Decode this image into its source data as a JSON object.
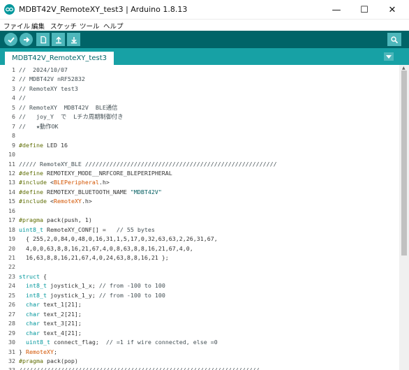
{
  "window": {
    "title": "MDBT42V_RemoteXY_test3 | Arduino 1.8.13",
    "min_glyph": "—",
    "max_glyph": "☐",
    "close_glyph": "✕"
  },
  "menu": [
    "ファイル",
    "編集",
    "スケッチ",
    "ツール",
    "ヘルプ"
  ],
  "toolbar": {
    "verify": "verify-icon",
    "upload": "upload-icon",
    "new": "new-icon",
    "open": "open-icon",
    "save": "save-icon",
    "serial_monitor": "serial-monitor-icon"
  },
  "tabs": [
    {
      "label": "MDBT42V_RemoteXY_test3",
      "active": true
    }
  ],
  "colors": {
    "toolbar_bg": "#006468",
    "tabbar_bg": "#17a1a5",
    "button_bg": "#4db7bb",
    "keyword": "#00979c",
    "preprocessor": "#5e6d03",
    "type": "#d35400",
    "comment": "#434f54"
  },
  "editor": {
    "lines": [
      [
        [
          "cm",
          "//  2024/10/07"
        ]
      ],
      [
        [
          "cm",
          "// MDBT42V nRF52832"
        ]
      ],
      [
        [
          "cm",
          "// RemoteXY test3"
        ]
      ],
      [
        [
          "cm",
          "//"
        ]
      ],
      [
        [
          "cm",
          "// RemoteXY  MDBT42V  BLE通信"
        ]
      ],
      [
        [
          "cm",
          "//   joy_Y  で  Lチカ周期制御付き"
        ]
      ],
      [
        [
          "cm",
          "//   ★動作OK"
        ]
      ],
      [],
      [
        [
          "pp",
          "#define"
        ],
        [
          "tx",
          " LED 16"
        ]
      ],
      [],
      [
        [
          "cm",
          "///// RemoteXY_BLE ///////////////////////////////////////////////////////"
        ]
      ],
      [
        [
          "pp",
          "#define"
        ],
        [
          "tx",
          " REMOTEXY_MODE__NRFCORE_BLEPERIPHERAL"
        ]
      ],
      [
        [
          "pp",
          "#include"
        ],
        [
          "tx",
          " <"
        ],
        [
          "ty",
          "BLEPeripheral"
        ],
        [
          "tx",
          ".h>"
        ]
      ],
      [
        [
          "pp",
          "#define"
        ],
        [
          "tx",
          " REMOTEXY_BLUETOOTH_NAME "
        ],
        [
          "str",
          "\"MDBT42V\""
        ]
      ],
      [
        [
          "pp",
          "#include"
        ],
        [
          "tx",
          " <"
        ],
        [
          "ty",
          "RemoteXY"
        ],
        [
          "tx",
          ".h>"
        ]
      ],
      [],
      [
        [
          "pp",
          "#pragma"
        ],
        [
          "tx",
          " pack(push, 1)"
        ]
      ],
      [
        [
          "kw",
          "uint8_t"
        ],
        [
          "tx",
          " RemoteXY_CONF[] =   "
        ],
        [
          "cm",
          "// 55 bytes"
        ]
      ],
      [
        [
          "tx",
          "  { 255,2,0,84,0,48,0,16,31,1,5,17,0,32,63,63,2,26,31,67,"
        ]
      ],
      [
        [
          "tx",
          "  4,0,0,63,8,8,16,21,67,4,0,8,63,8,8,16,21,67,4,0,"
        ]
      ],
      [
        [
          "tx",
          "  16,63,8,8,16,21,67,4,0,24,63,8,8,16,21 };"
        ]
      ],
      [],
      [
        [
          "kw",
          "struct"
        ],
        [
          "tx",
          " {"
        ]
      ],
      [
        [
          "tx",
          "  "
        ],
        [
          "kw",
          "int8_t"
        ],
        [
          "tx",
          " joystick_1_x; "
        ],
        [
          "cm",
          "// from -100 to 100"
        ]
      ],
      [
        [
          "tx",
          "  "
        ],
        [
          "kw",
          "int8_t"
        ],
        [
          "tx",
          " joystick_1_y; "
        ],
        [
          "cm",
          "// from -100 to 100"
        ]
      ],
      [
        [
          "tx",
          "  "
        ],
        [
          "kw",
          "char"
        ],
        [
          "tx",
          " text_1[21];"
        ]
      ],
      [
        [
          "tx",
          "  "
        ],
        [
          "kw",
          "char"
        ],
        [
          "tx",
          " text_2[21];"
        ]
      ],
      [
        [
          "tx",
          "  "
        ],
        [
          "kw",
          "char"
        ],
        [
          "tx",
          " text_3[21];"
        ]
      ],
      [
        [
          "tx",
          "  "
        ],
        [
          "kw",
          "char"
        ],
        [
          "tx",
          " text_4[21];"
        ]
      ],
      [
        [
          "tx",
          "  "
        ],
        [
          "kw",
          "uint8_t"
        ],
        [
          "tx",
          " connect_flag;  "
        ],
        [
          "cm",
          "// =1 if wire connected, else =0"
        ]
      ],
      [
        [
          "tx",
          "} "
        ],
        [
          "rx",
          "RemoteXY"
        ],
        [
          "tx",
          ";"
        ]
      ],
      [
        [
          "pp",
          "#pragma"
        ],
        [
          "tx",
          " pack(pop)"
        ]
      ],
      [
        [
          "cm",
          "/////////////////////////////////////////////////////////////////////"
        ]
      ]
    ]
  }
}
